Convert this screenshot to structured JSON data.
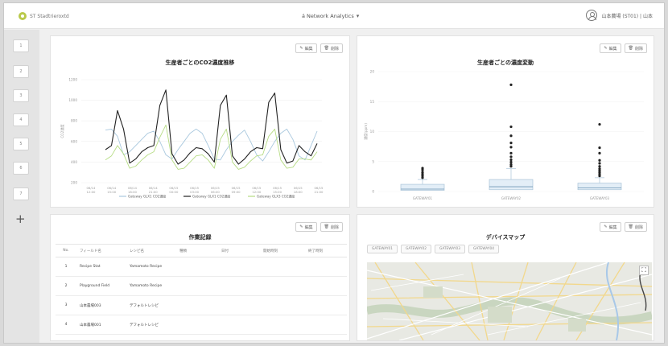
{
  "app": {
    "brand": "ST Stadtrieroxtd",
    "workspace": "á Network Analytics",
    "user_label": "山本農場 (ST01) | 山本"
  },
  "sidebar": {
    "items": [
      "1",
      "2",
      "3",
      "4",
      "5",
      "6",
      "7"
    ],
    "add_label": "+"
  },
  "panel_actions": {
    "edit": "編集",
    "delete": "削除"
  },
  "co2_panel": {
    "title": "生産者ごとのCO2濃度推移"
  },
  "box_panel": {
    "title": "生産者ごとの濃度変動"
  },
  "table_panel": {
    "title": "作業記録",
    "columns": [
      "No.",
      "フィールド名",
      "レシピ名",
      "種類",
      "日付",
      "開始時刻",
      "終了時刻"
    ],
    "rows": [
      [
        "1",
        "Recipe Stat",
        "Yamamoto Recipe",
        "",
        "",
        "",
        ""
      ],
      [
        "2",
        "Playground Field",
        "Yamamoto Recipe",
        "",
        "",
        "",
        ""
      ],
      [
        "3",
        "山本農場003",
        "デフォルトレシピ",
        "",
        "",
        "",
        ""
      ],
      [
        "4",
        "山本農場001",
        "デフォルトレシピ",
        "",
        "",
        "",
        ""
      ]
    ]
  },
  "map_panel": {
    "title": "デバイスマップ",
    "tabs": [
      "GATEWAY01",
      "GATEWAY02",
      "GATEWAY03",
      "GATEWAY04"
    ],
    "expand_icon": "expand-icon"
  },
  "chart_data": [
    {
      "type": "line",
      "title": "生産者ごとのCO2濃度推移",
      "ylabel": "CO2濃度",
      "ylim": [
        200,
        1200
      ],
      "yticks": [
        "200",
        "400",
        "600",
        "800",
        "1000",
        "1200"
      ],
      "xticks": [
        "06/14 12:00",
        "06/14 15:00",
        "06/14 18:00",
        "06/14 21:00",
        "06/15 00:00",
        "06/15 03:00",
        "06/15 06:00",
        "06/15 09:00",
        "06/15 12:00",
        "06/15 15:00",
        "06/15 18:00",
        "06/15 21:00"
      ],
      "series": [
        {
          "name": "Gateway GLX1 CO2濃度",
          "color": "#a9c8de",
          "values": [
            710,
            720,
            650,
            470,
            500,
            560,
            620,
            680,
            700,
            600,
            470,
            430,
            520,
            600,
            680,
            720,
            680,
            560,
            430,
            420,
            520,
            600,
            660,
            710,
            600,
            470,
            410,
            500,
            600,
            680,
            720,
            620,
            460,
            420,
            560,
            700
          ]
        },
        {
          "name": "Gateway GLX1 CO2濃度",
          "color": "#222222",
          "values": [
            520,
            560,
            900,
            720,
            390,
            430,
            500,
            540,
            560,
            950,
            1100,
            480,
            380,
            420,
            490,
            540,
            530,
            480,
            400,
            950,
            1050,
            460,
            380,
            430,
            500,
            540,
            530,
            980,
            1070,
            520,
            390,
            410,
            560,
            500,
            460,
            580
          ]
        },
        {
          "name": "Gateway GLX3 CO2濃度",
          "color": "#b6dc84",
          "values": [
            420,
            460,
            560,
            480,
            340,
            360,
            420,
            470,
            500,
            640,
            760,
            420,
            330,
            340,
            400,
            460,
            470,
            420,
            340,
            620,
            720,
            400,
            330,
            350,
            410,
            460,
            470,
            650,
            720,
            420,
            340,
            350,
            430,
            430,
            420,
            500
          ]
        }
      ]
    },
    {
      "type": "box",
      "title": "生産者ごとの濃度変動",
      "ylabel": "濃度(ppm)",
      "ylim": [
        0,
        20
      ],
      "yticks": [
        "0",
        "5",
        "10",
        "15",
        "20"
      ],
      "categories": [
        "GATEWAY01",
        "GATEWAY02",
        "GATEWAY03"
      ],
      "boxes": [
        {
          "whisker_low": 0.2,
          "q1": 0.2,
          "median": 0.4,
          "q3": 1.2,
          "whisker_high": 2.0,
          "outliers": [
            2.3,
            2.6,
            2.9,
            3.2,
            3.6,
            3.9
          ]
        },
        {
          "whisker_low": 0.2,
          "q1": 0.3,
          "median": 0.8,
          "q3": 2.0,
          "whisker_high": 3.8,
          "outliers": [
            4.2,
            4.5,
            4.9,
            5.3,
            5.8,
            6.4,
            7.4,
            8.1,
            9.3,
            10.8,
            17.8
          ]
        },
        {
          "whisker_low": 0.2,
          "q1": 0.3,
          "median": 0.6,
          "q3": 1.4,
          "whisker_high": 2.3,
          "outliers": [
            2.6,
            2.9,
            3.2,
            3.5,
            3.8,
            4.2,
            4.7,
            5.2,
            6.4,
            7.3,
            11.2
          ]
        }
      ]
    }
  ]
}
